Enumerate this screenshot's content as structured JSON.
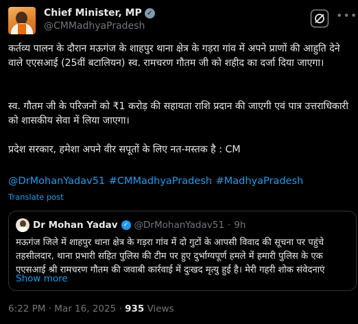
{
  "tweet": {
    "author": {
      "display_name": "Chief Minister, MP",
      "handle": "@CMMadhyaPradesh",
      "verified_badge": "grey-check-icon"
    },
    "paragraphs": [
      "कर्तव्य पालन के दौरान मऊगंज के शाहपुर थाना क्षेत्र के गड़रा गांव में अपने प्राणों की आहुति देने वाले एएसआई (25वीं बटालियन) स्व. रामचरण गौतम जी को शहीद का दर्जा दिया जाएगा।",
      "स्व. गौतम जी के परिजनों को ₹1 करोड़ की सहायता राशि प्रदान की जाएगी एवं पात्र उत्तराधिकारी को शासकीय सेवा में लिया जाएगा।",
      "प्रदेश सरकार, हमेशा अपने वीर सपूतों के लिए नत-मस्तक है : CM"
    ],
    "hashtags": "@DrMohanYadav51 #CMMadhyaPradesh #MadhyaPradesh",
    "translate_label": "Translate post",
    "quoted": {
      "display_name": "Dr Mohan Yadav",
      "handle": "@DrMohanYadav51",
      "separator": "·",
      "time": "9h",
      "text": "मऊगंज जिले में शाहपुर थाना क्षेत्र के गड़रा गांव में दो गुटों के आपसी विवाद की सूचना पर पहुंचे तहसीलदार, थाना प्रभारी सहित पुलिस की टीम पर हुए दुर्भाग्यपूर्ण हमले में हमारी पुलिस के एक एएसआई श्री रामचरण गौतम की जवाबी कार्रवाई में दुःखद मृत्यु हुई है। मेरी गहरी शोक संवेदनाएं",
      "show_more": "Show more"
    },
    "meta": {
      "time": "6:22 PM",
      "separator": "·",
      "date": "Mar 16, 2025",
      "views_count": "935",
      "views_label": "Views"
    }
  },
  "colors": {
    "background": "#000000",
    "text": "#e7e9ea",
    "secondary_text": "#71767b",
    "link": "#1d9bf0",
    "border": "#2f3336"
  }
}
